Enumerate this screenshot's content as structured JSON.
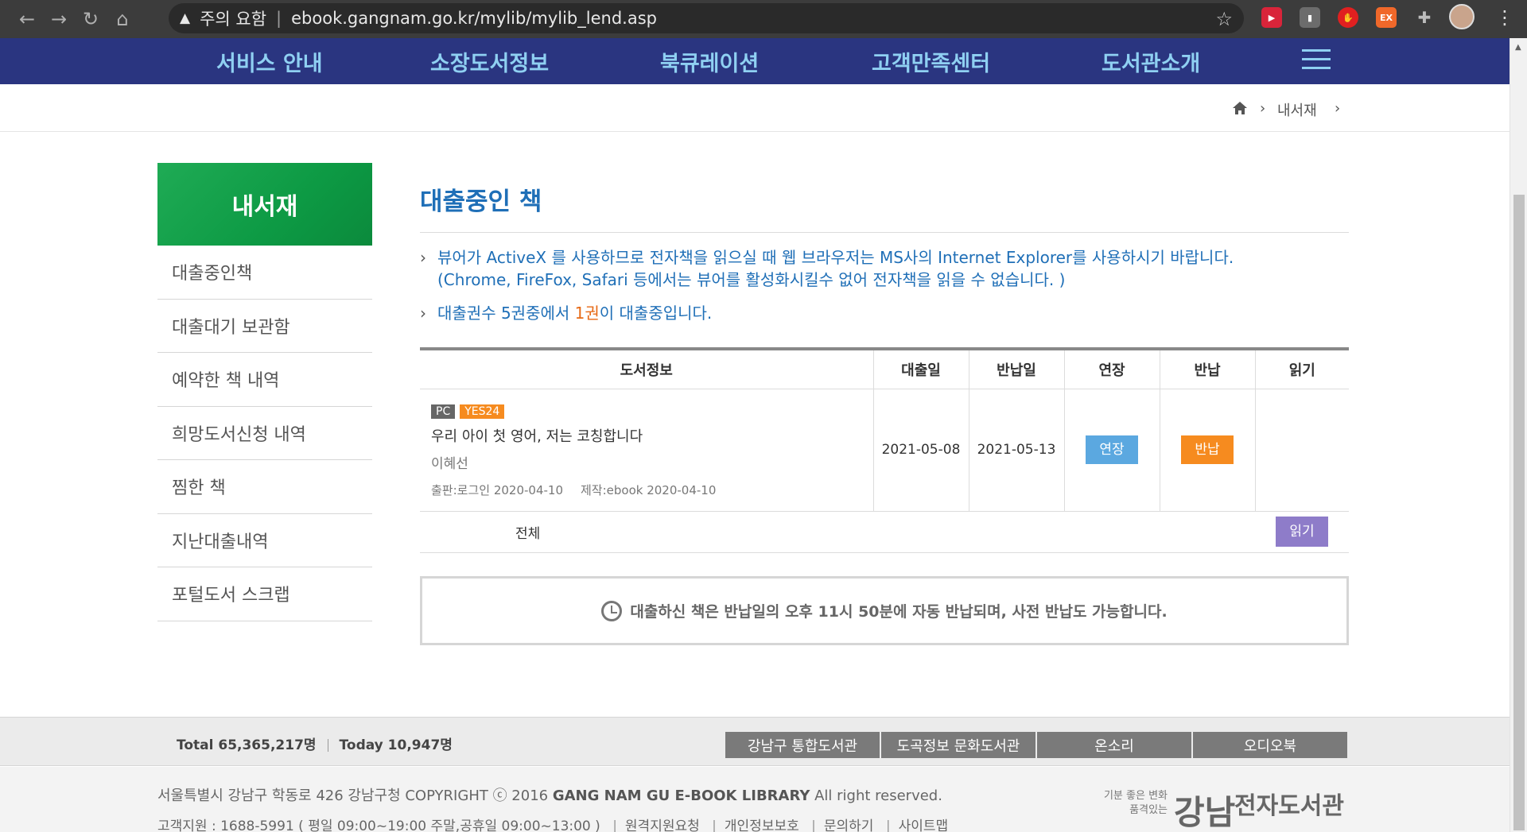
{
  "browser": {
    "security_label": "주의 요함",
    "url": "ebook.gangnam.go.kr/mylib/mylib_lend.asp",
    "ext_ex_label": "EX"
  },
  "nav": {
    "items": [
      "서비스 안내",
      "소장도서정보",
      "북큐레이션",
      "고객만족센터",
      "도서관소개"
    ]
  },
  "breadcrumb": {
    "current": "내서재"
  },
  "sidebar": {
    "title": "내서재",
    "items": [
      "대출중인책",
      "대출대기 보관함",
      "예약한 책 내역",
      "희망도서신청 내역",
      "찜한 책",
      "지난대출내역",
      "포털도서 스크랩"
    ]
  },
  "main": {
    "title": "대출중인 책",
    "notice1_line1": "뷰어가 ActiveX 를 사용하므로 전자책을 읽으실 때 웹 브라우저는 MS사의 Internet Explorer를 사용하시기 바랍니다.",
    "notice1_line2": "(Chrome, FireFox, Safari 등에서는 뷰어를 활성화시킬수 없어 전자책을 읽을 수 없습니다. )",
    "notice2_prefix": "대출권수 5권중에서 ",
    "notice2_count": "1권",
    "notice2_suffix": "이 대출중입니다."
  },
  "table": {
    "headers": [
      "도서정보",
      "대출일",
      "반납일",
      "연장",
      "반납",
      "읽기"
    ],
    "rows": [
      {
        "badge_pc": "PC",
        "badge_vendor": "YES24",
        "title": "우리 아이 첫 영어, 저는 코칭합니다",
        "author": "이혜선",
        "publisher": "출판:로그인 2020-04-10",
        "production": "제작:ebook 2020-04-10",
        "lend_date": "2021-05-08",
        "due_date": "2021-05-13",
        "extend_label": "연장",
        "return_label": "반납"
      }
    ],
    "total_label": "전체",
    "read_label": "읽기"
  },
  "info_box": {
    "text": "대출하신 책은 반납일의 오후 11시 50분에 자동 반납되며, 사전 반납도 가능합니다."
  },
  "footer": {
    "total": "Total 65,365,217명",
    "today": "Today 10,947명",
    "links": [
      "강남구 통합도서관",
      "도곡정보 문화도서관",
      "온소리",
      "오디오북"
    ],
    "address_prefix": "서울특별시 강남구 학동로 426 강남구청 COPYRIGHT ⓒ 2016 ",
    "address_bold": "GANG NAM GU E-BOOK LIBRARY",
    "address_suffix": " All right reserved.",
    "contact_items": [
      "고객지원 : 1688-5991 ( 평일 09:00~19:00 주말,공휴일 09:00~13:00 )",
      "원격지원요청",
      "개인정보보호",
      "문의하기",
      "사이트맵"
    ],
    "logo_slogan_1": "기분 좋은 변화",
    "logo_slogan_2": "품격있는",
    "logo_name": "강남",
    "logo_lib": "전자도서관"
  },
  "colors": {
    "nav_bg": "#2a3580",
    "nav_text": "#8fd0f2",
    "title_blue": "#1f6fb7",
    "sidebar_green": "#0d9a44",
    "accent_orange": "#f68b1f",
    "extend_blue": "#5ba8e0",
    "read_purple": "#8e7cc9"
  },
  "icons": [
    "back-arrow-icon",
    "forward-arrow-icon",
    "reload-icon",
    "home-icon",
    "warning-icon",
    "star-icon",
    "extension-puzzle-icon",
    "hamburger-menu-icon",
    "breadcrumb-home-icon",
    "chevron-right-icon",
    "clock-icon"
  ]
}
